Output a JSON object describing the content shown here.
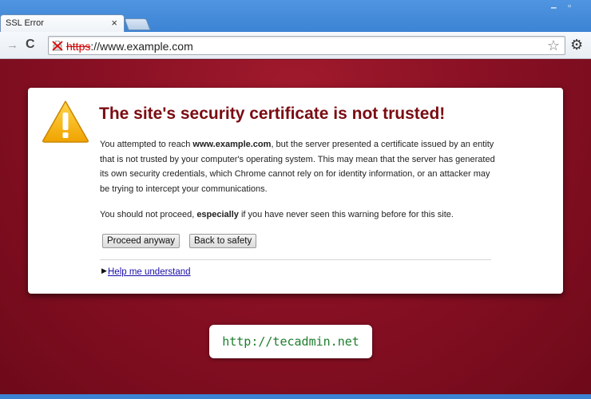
{
  "tab": {
    "title": "SSL Error",
    "close": "×"
  },
  "window": {
    "minimize": "‒",
    "maximize": "▫"
  },
  "toolbar": {
    "forward": "→",
    "reload": "C",
    "url_scheme": "https",
    "url_rest": "://www.example.com",
    "star": "☆",
    "wrench": "⚙"
  },
  "interstitial": {
    "headline": "The site's security certificate is not trusted!",
    "para1_pre": "You attempted to reach ",
    "para1_domain": "www.example.com",
    "para1_post": ", but the server presented a certificate issued by an entity that is not trusted by your computer's operating system. This may mean that the server has generated its own security credentials, which Chrome cannot rely on for identity information, or an attacker may be trying to intercept your communications.",
    "para2_pre": "You should not proceed, ",
    "para2_bold": "especially",
    "para2_post": " if you have never seen this warning before for this site.",
    "proceed_label": "Proceed anyway",
    "back_label": "Back to safety",
    "help_arrow": "▶",
    "help_link": "Help me understand"
  },
  "watermark": "http://tecadmin.net",
  "colors": {
    "background": "#8a1024",
    "headline": "#7a0c12",
    "chrome_blue": "#3c83d4",
    "warning_yellow": "#f5b400",
    "watermark_green": "#1d7d2c"
  }
}
